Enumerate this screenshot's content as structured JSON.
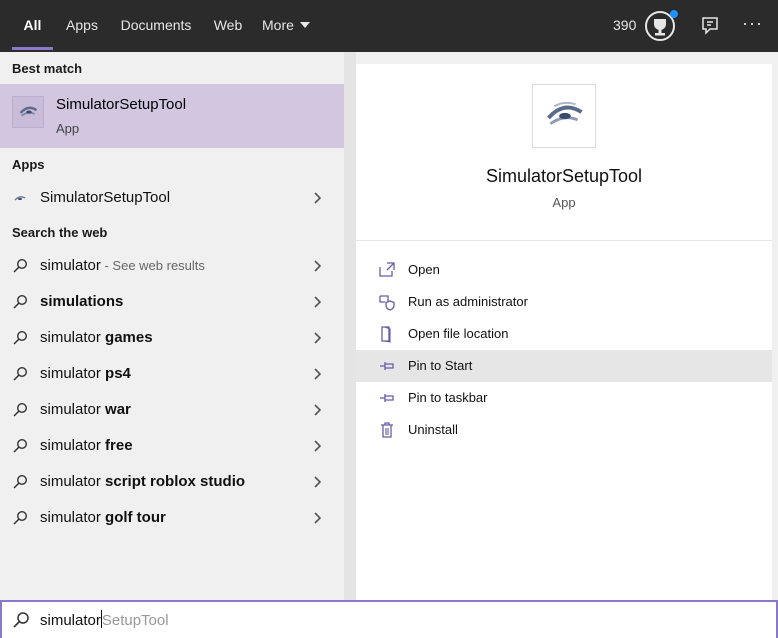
{
  "tabs": [
    {
      "label": "All"
    },
    {
      "label": "Apps"
    },
    {
      "label": "Documents"
    },
    {
      "label": "Web"
    },
    {
      "label": "More"
    }
  ],
  "topbar": {
    "points": "390",
    "more_dots": "···"
  },
  "left": {
    "best_match_label": "Best match",
    "best_match": {
      "title_bold": "Simulator",
      "title_rest": "SetupTool",
      "subtitle": "App"
    },
    "apps_label": "Apps",
    "app_item": {
      "bold": "Simulator",
      "rest": "SetupTool"
    },
    "web_label": "Search the web",
    "web_items": [
      {
        "plain": "simulator",
        "bold": "",
        "dim": " - See web results"
      },
      {
        "plain": "",
        "bold": "simulations",
        "dim": ""
      },
      {
        "plain": "simulator ",
        "bold": "games",
        "dim": ""
      },
      {
        "plain": "simulator ",
        "bold": "ps4",
        "dim": ""
      },
      {
        "plain": "simulator ",
        "bold": "war",
        "dim": ""
      },
      {
        "plain": "simulator ",
        "bold": "free",
        "dim": ""
      },
      {
        "plain": "simulator ",
        "bold": "script roblox studio",
        "dim": ""
      },
      {
        "plain": "simulator ",
        "bold": "golf tour",
        "dim": ""
      }
    ]
  },
  "right": {
    "app_name": "SimulatorSetupTool",
    "app_type": "App",
    "actions": [
      {
        "label": "Open",
        "icon": "open-icon"
      },
      {
        "label": "Run as administrator",
        "icon": "shield-icon"
      },
      {
        "label": "Open file location",
        "icon": "file-location-icon"
      },
      {
        "label": "Pin to Start",
        "icon": "pin-icon"
      },
      {
        "label": "Pin to taskbar",
        "icon": "pin-icon"
      },
      {
        "label": "Uninstall",
        "icon": "trash-icon"
      }
    ]
  },
  "search": {
    "typed": "simulator",
    "suggestion": "SetupTool"
  },
  "colors": {
    "accent": "#8a78c8",
    "selected_bg": "#d2c6e0",
    "topbar_bg": "#2b2b2b",
    "badge": "#1e90ff"
  }
}
